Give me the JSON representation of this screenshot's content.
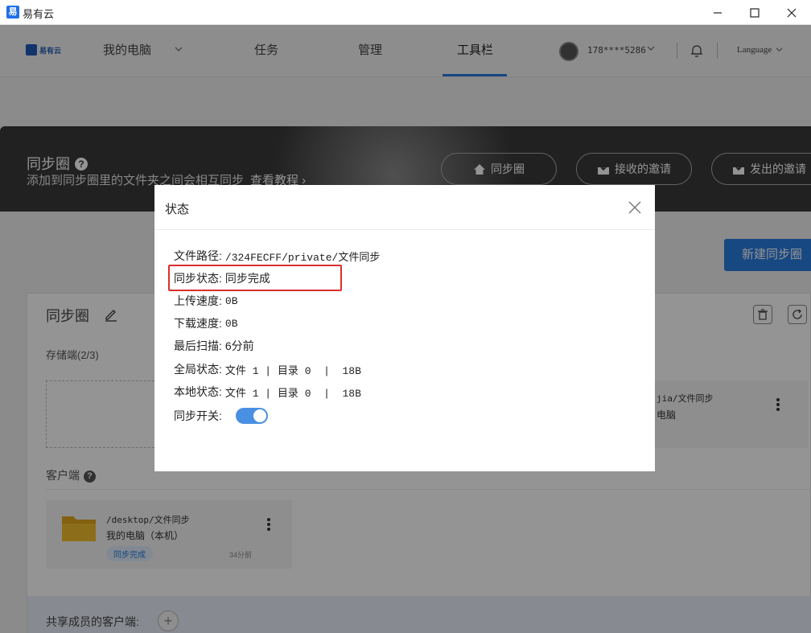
{
  "window": {
    "app_icon": "易",
    "title": "易有云",
    "minimize_icon": "minimize-icon",
    "maximize_icon": "maximize-icon",
    "close_icon": "close-icon"
  },
  "nav": {
    "logo_text": "易有云",
    "my_computer": "我的电脑",
    "tasks": "任务",
    "manage": "管理",
    "toolbar": "工具栏",
    "phone": "178****5286",
    "language": "Language",
    "accent_color": "#2a7de1"
  },
  "hero": {
    "title": "同步圈",
    "help": "?",
    "subtitle": "添加到同步圈里的文件夹之间会相互同步",
    "tutorial_link": "查看教程 ›",
    "tabs": [
      "同步圈",
      "接收的邀请",
      "发出的邀请"
    ]
  },
  "page": {
    "new_button": "新建同步圈",
    "card_title": "同步圈",
    "storage_label": "存储端(2/3)",
    "storage_card": {
      "path": "jia/文件同步",
      "name": "电脑"
    },
    "client_label": "客户端",
    "client_help": "?",
    "client_card": {
      "path": "/desktop/文件同步",
      "name": "我的电脑（本机）",
      "status": "同步完成",
      "time": "34分前"
    },
    "members_label": "共享成员的客户端:",
    "add_symbol": "+"
  },
  "modal": {
    "title": "状态",
    "rows": [
      {
        "label": "文件路径:",
        "value": "/324FECFF/private/文件同步"
      },
      {
        "label": "同步状态:",
        "value": "同步完成"
      },
      {
        "label": "上传速度:",
        "value": "0B"
      },
      {
        "label": "下载速度:",
        "value": "0B"
      },
      {
        "label": "最后扫描:",
        "value": "6分前"
      },
      {
        "label": "全局状态:",
        "value": "文件 1 | 目录 0  |  18B"
      },
      {
        "label": "本地状态:",
        "value": "文件 1 | 目录 0  |  18B"
      }
    ],
    "toggle_label": "同步开关:",
    "toggle_on": true,
    "highlight_color": "#d9302c"
  }
}
